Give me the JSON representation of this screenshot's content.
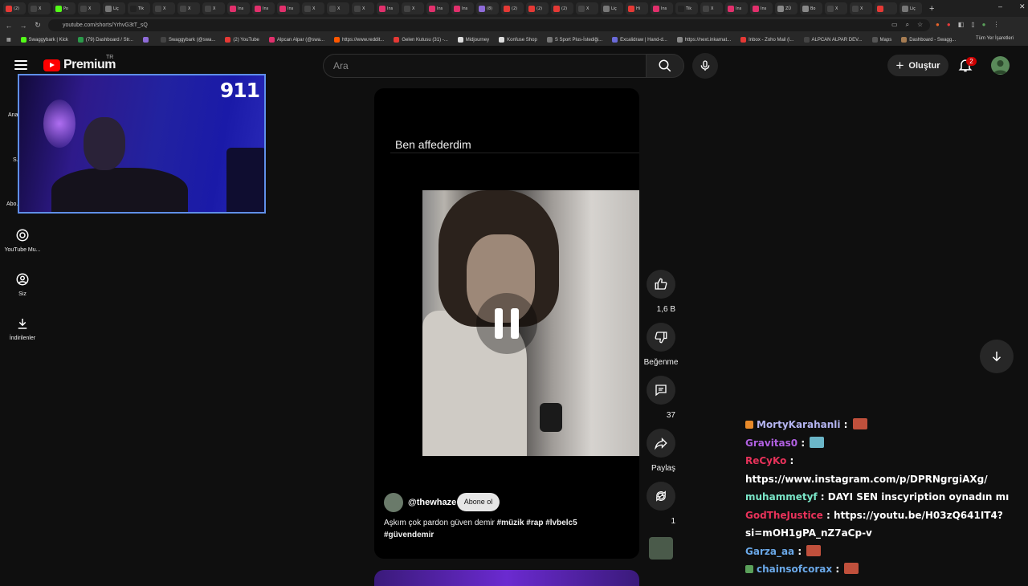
{
  "browser": {
    "tabs": [
      {
        "title": "(2)",
        "color": "#e53935"
      },
      {
        "title": "X",
        "color": "#444444"
      },
      {
        "title": "Po",
        "color": "#53fc18"
      },
      {
        "title": "X",
        "color": "#444444"
      },
      {
        "title": "Liç",
        "color": "#777777"
      },
      {
        "title": "Tik",
        "color": "#222222"
      },
      {
        "title": "X",
        "color": "#444444"
      },
      {
        "title": "X",
        "color": "#444444"
      },
      {
        "title": "X",
        "color": "#444444"
      },
      {
        "title": "Ins",
        "color": "#e1306c"
      },
      {
        "title": "Ins",
        "color": "#e1306c"
      },
      {
        "title": "Ins",
        "color": "#e1306c"
      },
      {
        "title": "X",
        "color": "#444444"
      },
      {
        "title": "X",
        "color": "#444444"
      },
      {
        "title": "X",
        "color": "#444444"
      },
      {
        "title": "Ins",
        "color": "#e1306c"
      },
      {
        "title": "X",
        "color": "#444444"
      },
      {
        "title": "Ins",
        "color": "#e1306c"
      },
      {
        "title": "Ins",
        "color": "#e1306c"
      },
      {
        "title": "(8)",
        "color": "#8e6bd8"
      },
      {
        "title": "(2)",
        "color": "#e53935"
      },
      {
        "title": "(2)",
        "color": "#e53935"
      },
      {
        "title": "(2)",
        "color": "#e53935"
      },
      {
        "title": "X",
        "color": "#444444"
      },
      {
        "title": "Liç",
        "color": "#777777"
      },
      {
        "title": "Hi",
        "color": "#e53935"
      },
      {
        "title": "Ins",
        "color": "#e1306c"
      },
      {
        "title": "Tik",
        "color": "#222222"
      },
      {
        "title": "X",
        "color": "#444444"
      },
      {
        "title": "Ins",
        "color": "#e1306c"
      },
      {
        "title": "Ins",
        "color": "#e1306c"
      },
      {
        "title": "ZÜ",
        "color": "#888888"
      },
      {
        "title": "Bo",
        "color": "#888888"
      },
      {
        "title": "X",
        "color": "#444444"
      },
      {
        "title": "X",
        "color": "#444444"
      },
      {
        "title": "",
        "color": "#e53935"
      },
      {
        "title": "Liç",
        "color": "#777777"
      }
    ],
    "url": "youtube.com/shorts/YrhvG3tT_sQ",
    "bookmarks": [
      "Swaggybark | Kick",
      "(79) Dashboard / Str...",
      "",
      "Swaggybark (@swa...",
      "(2) YouTube",
      "Alpcan Alpar (@swa...",
      "https://www.reddit...",
      "Gelen Kutusu (31) -...",
      "Midjourney",
      "Konfuse Shop",
      "S Sport Plus-İstediği...",
      "Excalidraw | Hand-d...",
      "https://next.inkarnat...",
      "Inbox - Zoho Mail (i...",
      "ALPCAN ALPAR DEV...",
      "Maps",
      "Dashboard - Swagg..."
    ],
    "all_bookmarks": "Tüm Yer İşaretleri"
  },
  "header": {
    "logo_word": "Premium",
    "region": "TR",
    "search_placeholder": "Ara",
    "create_label": "Oluştur",
    "notification_count": "2"
  },
  "sidebar": {
    "items": [
      {
        "label": "Ana...",
        "icon": "home-icon"
      },
      {
        "label": "S...",
        "icon": "shorts-icon"
      },
      {
        "label": "Abo...",
        "icon": "subscriptions-icon"
      },
      {
        "label": "YouTube Mu...",
        "icon": "youtube-music-icon"
      },
      {
        "label": "Siz",
        "icon": "you-icon"
      },
      {
        "label": "İndirilenler",
        "icon": "download-icon"
      }
    ]
  },
  "webcam": {
    "overlay_number": "911"
  },
  "short": {
    "caption": "Ben affederdim",
    "channel": "@thewhaze",
    "subscribe_label": "Abone ol",
    "desc_text": "Aşkım çok pardon   güven demir ",
    "hashtags_line1": "#müzik #rap #lvbelc5",
    "hashtags_line2": "#güvendemir"
  },
  "actions": {
    "like_count": "1,6 B",
    "dislike_label": "Beğenme",
    "comment_count": "37",
    "share_label": "Paylaş",
    "remix_count": "1"
  },
  "chat": [
    {
      "user": "MortyKarahanli",
      "color": "#b4b4f0",
      "text": "",
      "emote": "#c0503c",
      "prefix": "#e88a2a"
    },
    {
      "user": "Gravitas0",
      "color": "#b060e0",
      "text": "",
      "emote": "#6bb6c8"
    },
    {
      "user": "ReCyKo",
      "color": "#e8325a",
      "text": "https://www.instagram.com/p/DPRNgrgiAXg/"
    },
    {
      "user": "muhammetyf",
      "color": "#7ae6c8",
      "text": "DAYI SEN inscyription oynadın mı"
    },
    {
      "user": "GodTheJustice",
      "color": "#e8325a",
      "text": "https://youtu.be/H03zQ641IT4?si=mOH1gPA_nZ7aCp-v"
    },
    {
      "user": "Garza_aa",
      "color": "#6aa8e8",
      "text": "",
      "emote": "#c0503c"
    },
    {
      "user": "chainsofcorax",
      "color": "#6aa8e8",
      "text": "",
      "emote": "#c0503c",
      "prefix": "#5aa05a"
    }
  ]
}
